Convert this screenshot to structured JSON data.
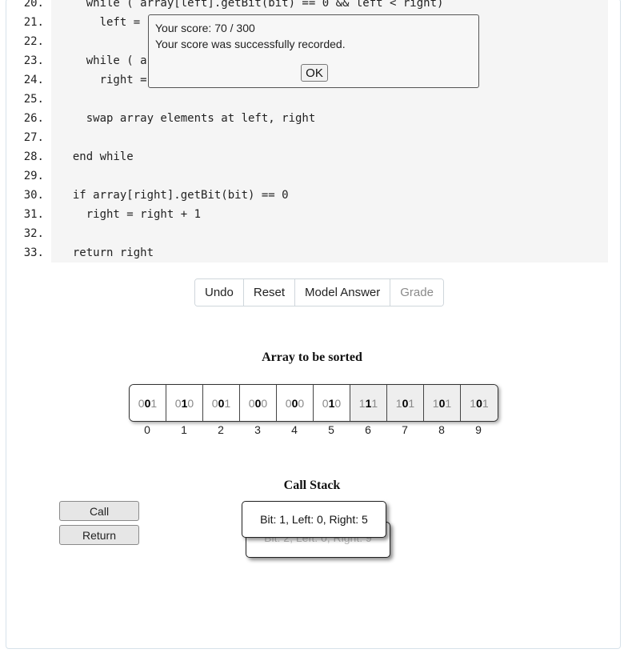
{
  "code": {
    "lines": [
      {
        "num": "20.",
        "text": "    while ( array[left].getBit(bit) == 0 && left < right)"
      },
      {
        "num": "21.",
        "text": "      left = "
      },
      {
        "num": "22.",
        "text": ""
      },
      {
        "num": "23.",
        "text": "    while ( a"
      },
      {
        "num": "24.",
        "text": "      right ="
      },
      {
        "num": "25.",
        "text": ""
      },
      {
        "num": "26.",
        "text": "    swap array elements at left, right"
      },
      {
        "num": "27.",
        "text": ""
      },
      {
        "num": "28.",
        "text": "  end while"
      },
      {
        "num": "29.",
        "text": ""
      },
      {
        "num": "30.",
        "text": "  if array[right].getBit(bit) == 0"
      },
      {
        "num": "31.",
        "text": "    right = right + 1"
      },
      {
        "num": "32.",
        "text": ""
      },
      {
        "num": "33.",
        "text": "  return right"
      }
    ]
  },
  "dialog": {
    "score_line": "Your score: 70 / 300",
    "message": "Your score was successfully recorded.",
    "ok_label": "OK"
  },
  "toolbar": {
    "undo": "Undo",
    "reset": "Reset",
    "model_answer": "Model Answer",
    "grade": "Grade"
  },
  "array_section": {
    "title": "Array to be sorted",
    "cells": [
      {
        "pre": "0",
        "bit": "0",
        "post": "1",
        "index": "0",
        "shaded": false
      },
      {
        "pre": "0",
        "bit": "1",
        "post": "0",
        "index": "1",
        "shaded": false
      },
      {
        "pre": "0",
        "bit": "0",
        "post": "1",
        "index": "2",
        "shaded": false
      },
      {
        "pre": "0",
        "bit": "0",
        "post": "0",
        "index": "3",
        "shaded": false
      },
      {
        "pre": "0",
        "bit": "0",
        "post": "0",
        "index": "4",
        "shaded": false
      },
      {
        "pre": "0",
        "bit": "1",
        "post": "0",
        "index": "5",
        "shaded": false
      },
      {
        "pre": "1",
        "bit": "1",
        "post": "1",
        "index": "6",
        "shaded": true
      },
      {
        "pre": "1",
        "bit": "0",
        "post": "1",
        "index": "7",
        "shaded": true
      },
      {
        "pre": "1",
        "bit": "0",
        "post": "1",
        "index": "8",
        "shaded": true
      },
      {
        "pre": "1",
        "bit": "0",
        "post": "1",
        "index": "9",
        "shaded": true
      }
    ]
  },
  "call_stack": {
    "title": "Call Stack",
    "call_label": "Call",
    "return_label": "Return",
    "frames": [
      {
        "text": "Bit: 1, Left: 0, Right: 5"
      },
      {
        "text": "Bit: 2, Left: 0, Right: 9"
      }
    ]
  }
}
